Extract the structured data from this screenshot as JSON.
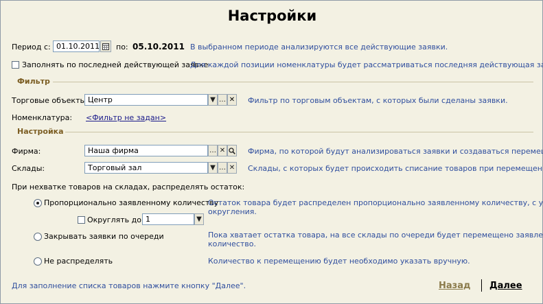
{
  "title": "Настройки",
  "period": {
    "from_label": "Период с:",
    "from_value": "01.10.2011",
    "to_label": "по:",
    "to_value": "05.10.2011",
    "hint": "В выбранном периоде анализируются все действующие заявки."
  },
  "fill_last": {
    "label": "Заполнять по последней действующей заявке",
    "checked": false,
    "hint": "Для каждой позиции номенклатуры будет рассматриваться последняя действующая заявка."
  },
  "filter": {
    "section": "Фильтр",
    "objects_label": "Торговые объекты:",
    "objects_value": "Центр",
    "objects_hint": "Фильтр по торговым объектам, с которых были сделаны заявки.",
    "nomenclature_label": "Номенклатура:",
    "nomenclature_link": "<Фильтр не задан>"
  },
  "settings": {
    "section": "Настройка",
    "firm_label": "Фирма:",
    "firm_value": "Наша фирма",
    "firm_hint": "Фирма, по которой будут анализироваться заявки и создаваться перемещения.",
    "warehouses_label": "Склады:",
    "warehouses_value": "Торговый зал",
    "warehouses_hint": "Склады, с которых будет происходить списание товаров при перемещении."
  },
  "distribution": {
    "question": "При нехватке товаров на складах, распределять остаток:",
    "options": [
      {
        "label": "Пропорционально заявленному количеству",
        "hint_line1": "Остаток товара будет распределен пропорционально заявленному количеству, с учетом",
        "hint_line2": "округления.",
        "selected": true
      },
      {
        "label": "Закрывать заявки по очереди",
        "hint_line1": "Пока хватает остатка товара, на все склады по очереди будет перемещено заявленное",
        "hint_line2": "количество.",
        "selected": false
      },
      {
        "label": "Не распределять",
        "hint_line1": "Количество к перемещению будет необходимо указать вручную.",
        "selected": false
      }
    ],
    "round_label": "Округлять до:",
    "round_checked": false,
    "round_value": "1"
  },
  "footer": {
    "hint": "Для заполнение списка товаров нажмите кнопку \"Далее\".",
    "back_label": "Назад",
    "next_label": "Далее"
  },
  "colors": {
    "hint": "#2f4e9e",
    "section": "#7b5d22",
    "background": "#f3f1e3"
  },
  "icons": [
    "calendar-icon",
    "dropdown-arrow-icon",
    "select-ellipsis-icon",
    "clear-x-icon",
    "search-icon"
  ]
}
